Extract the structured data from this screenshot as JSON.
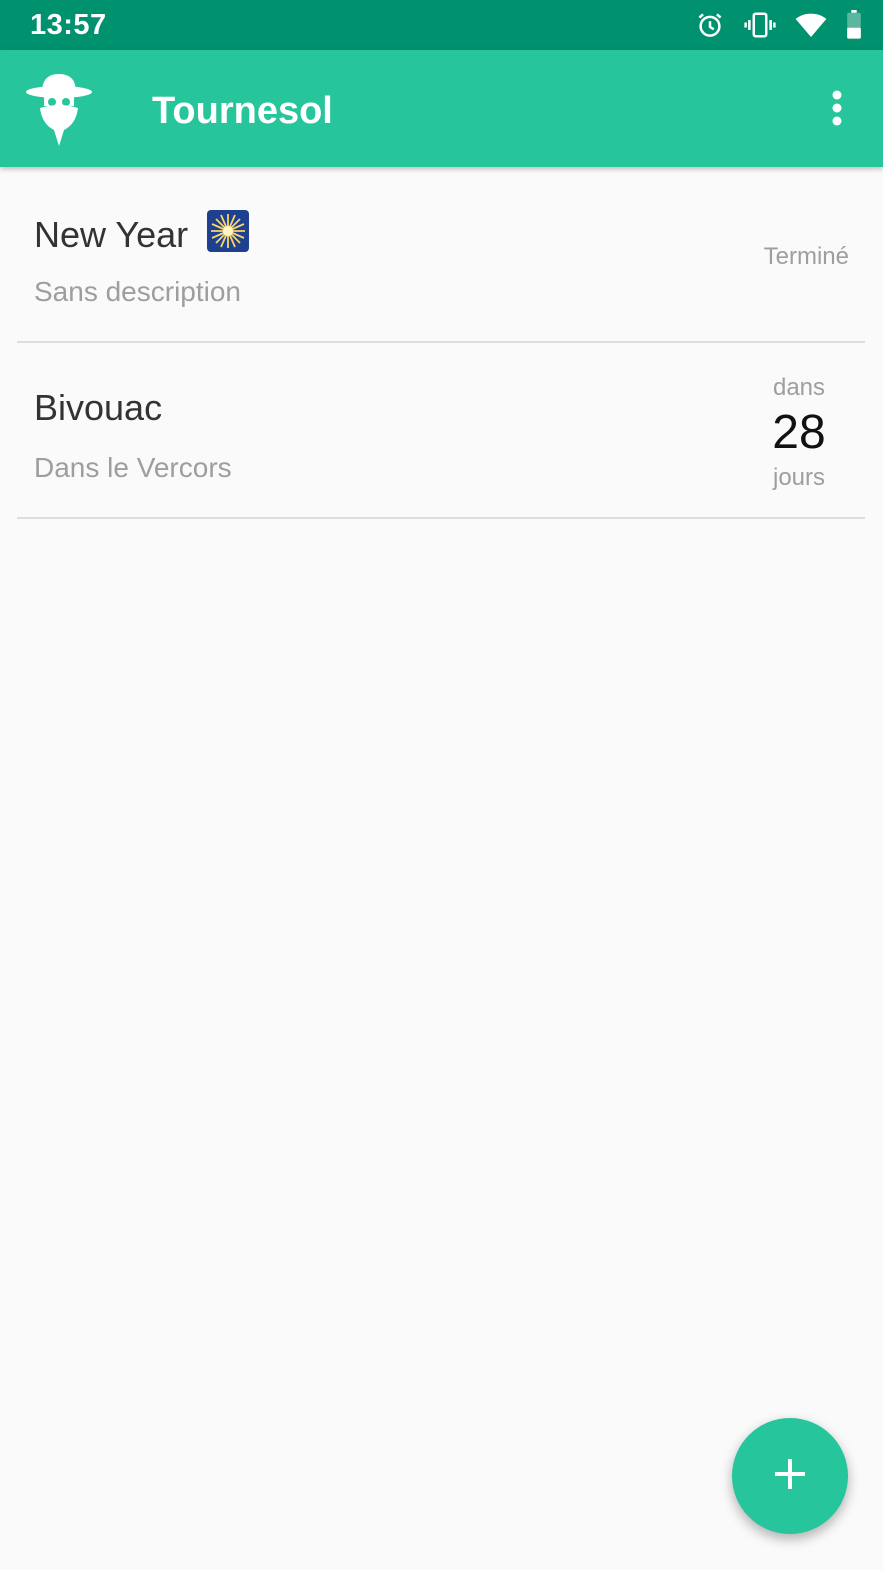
{
  "status_bar": {
    "time": "13:57",
    "icons": [
      "alarm-icon",
      "vibrate-icon",
      "wifi-icon",
      "battery-icon"
    ],
    "background": "#00916e"
  },
  "app_bar": {
    "title": "Tournesol",
    "logo_icon": "professor-logo-icon",
    "menu_icon": "more-vert-icon",
    "background": "#26c59b"
  },
  "events": [
    {
      "title": "New Year",
      "emoji_icon": "sparkler-emoji",
      "description": "Sans description",
      "status": "Terminé"
    },
    {
      "title": "Bivouac",
      "description": "Dans le Vercors",
      "countdown_prefix": "dans",
      "countdown_value": "28",
      "countdown_suffix": "jours"
    }
  ],
  "fab": {
    "icon": "add-icon",
    "background": "#26c59b"
  }
}
